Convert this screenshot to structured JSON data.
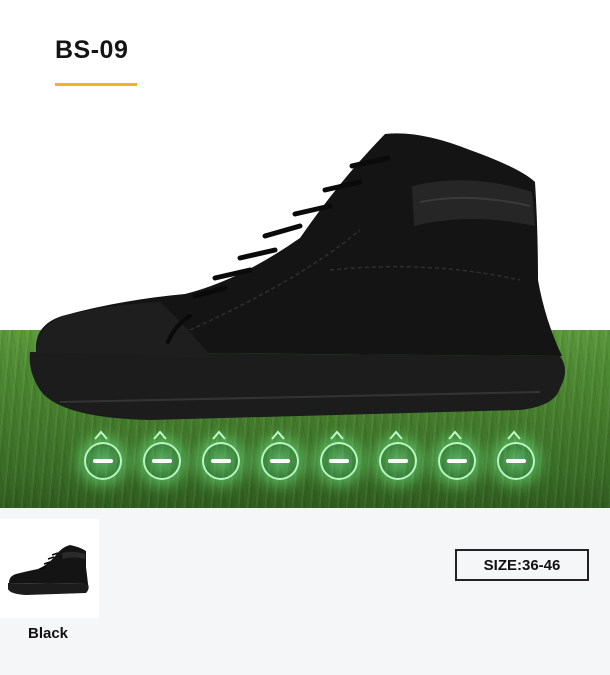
{
  "product": {
    "model": "BS-09",
    "accent_color": "#f0b323",
    "image_icon": "high-top-shoe-icon"
  },
  "ground_feedback": {
    "indicator_count": 8,
    "indicator_icon": "pressure-point-icon"
  },
  "variants": {
    "color_label": "Black",
    "thumbnail_icon": "shoe-thumbnail-icon"
  },
  "size": {
    "label": "SIZE:36-46"
  }
}
